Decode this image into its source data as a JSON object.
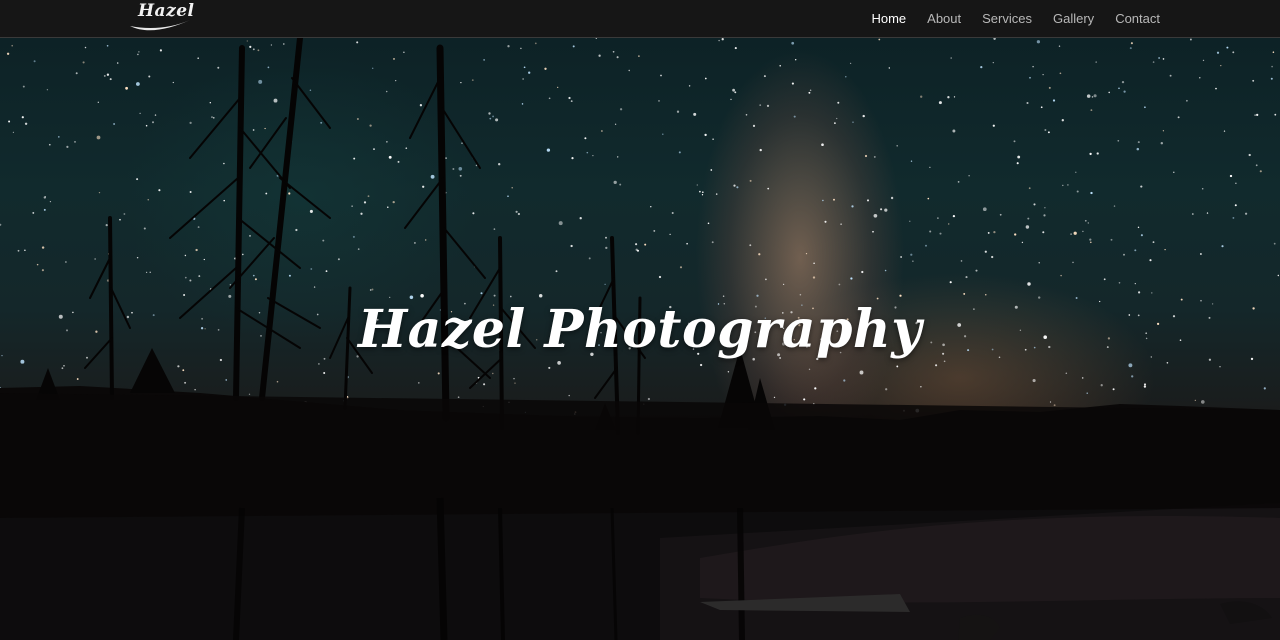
{
  "brand": {
    "logo_text": "Hazel"
  },
  "nav": {
    "items": [
      {
        "label": "Home",
        "active": true
      },
      {
        "label": "About",
        "active": false
      },
      {
        "label": "Services",
        "active": false
      },
      {
        "label": "Gallery",
        "active": false
      },
      {
        "label": "Contact",
        "active": false
      }
    ]
  },
  "hero": {
    "title": "Hazel Photography",
    "image_description_icon": "night-sky-milky-way-photo"
  },
  "colors": {
    "navbar_bg": "#161616",
    "nav_active": "#ffffff",
    "nav_inactive": "#b8b8b8",
    "hero_text": "#ffffff"
  }
}
